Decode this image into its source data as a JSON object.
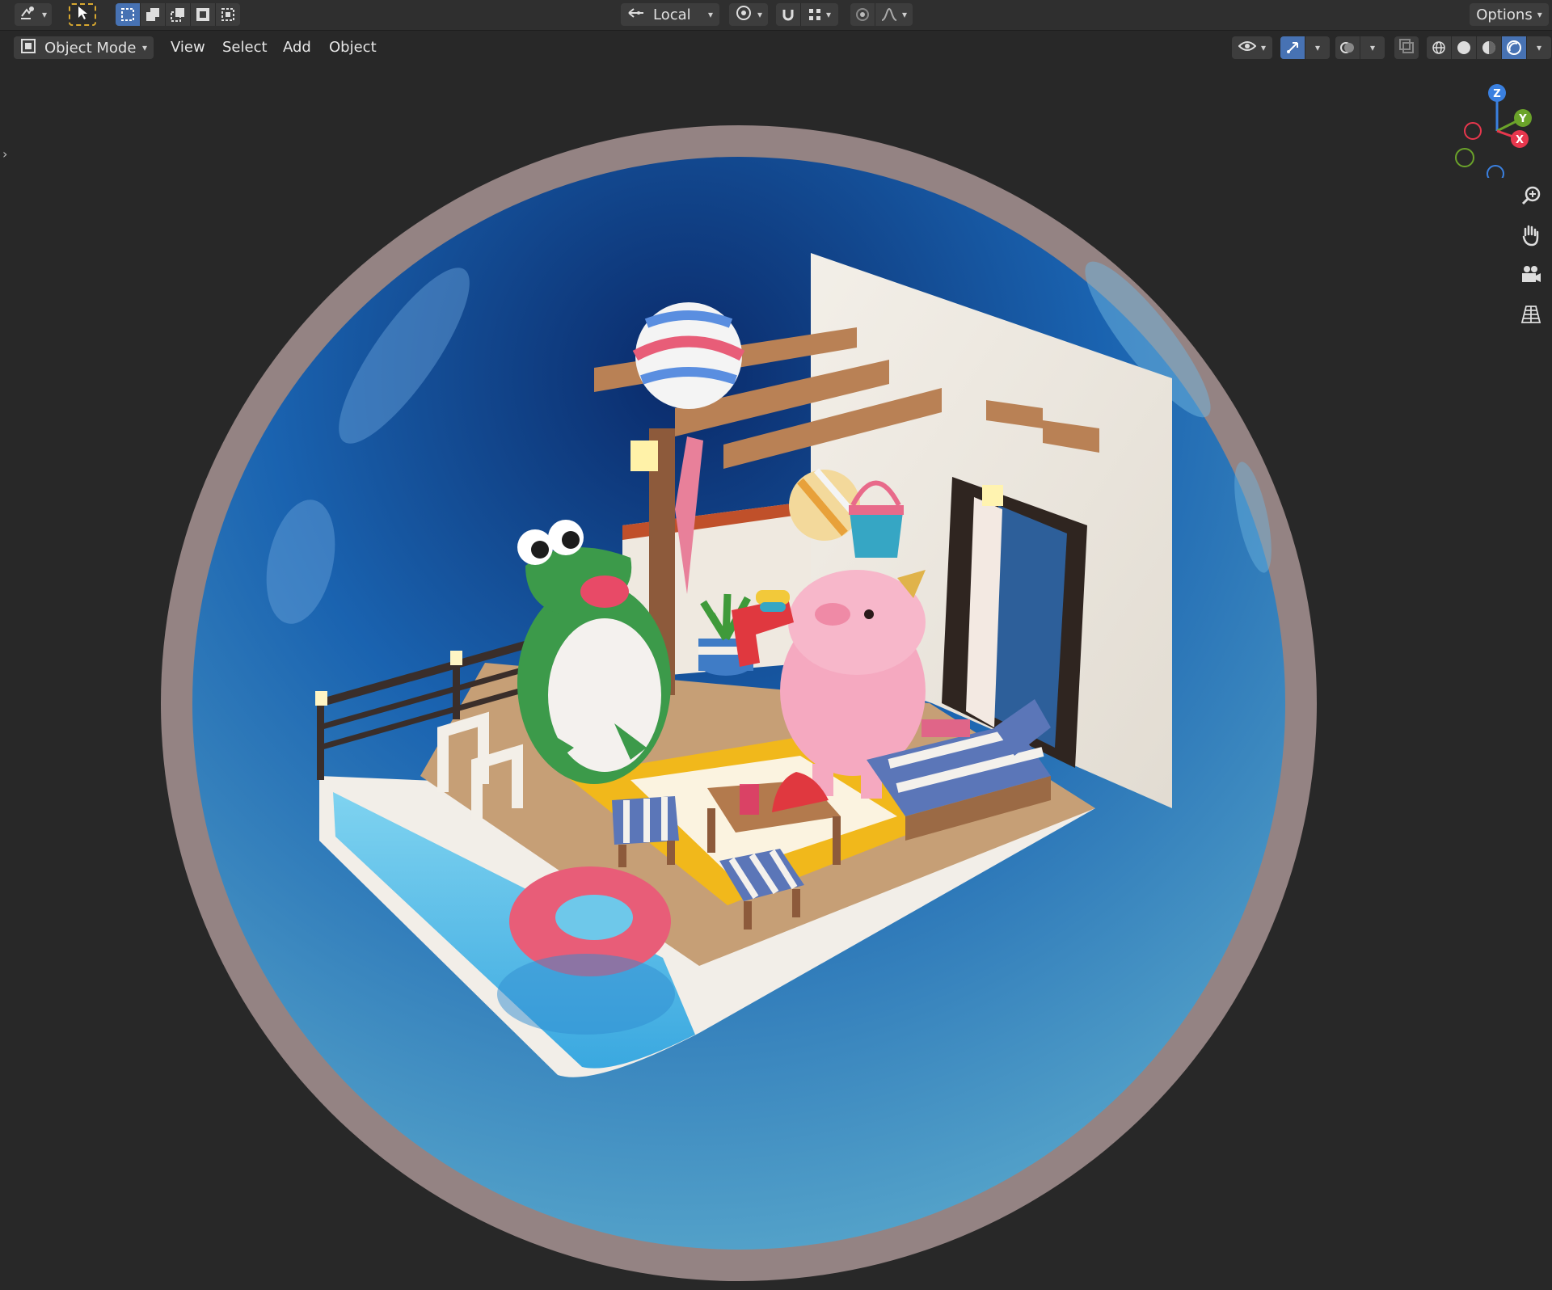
{
  "header": {
    "transform_orientation": "Local",
    "options_label": "Options"
  },
  "viewport_header": {
    "mode_label": "Object Mode",
    "menus": [
      "View",
      "Select",
      "Add",
      "Object"
    ]
  },
  "nav_gizmo": {
    "axes": {
      "z": "Z",
      "y": "Y",
      "x": "X"
    }
  },
  "icons": {
    "editor_type": "editor-type-icon",
    "select_tool": "select-cursor-icon",
    "pivot": "pivot-icon",
    "snap": "magnet-icon",
    "proportional": "proportional-edit-icon",
    "visibility": "eye-icon",
    "gizmo": "gizmo-icon",
    "overlay": "overlay-icon",
    "xray": "xray-icon",
    "shading_modes": [
      "wireframe-icon",
      "solid-icon",
      "material-icon",
      "rendered-icon"
    ],
    "nav": [
      "zoom-icon",
      "hand-icon",
      "camera-icon",
      "grid-icon"
    ]
  },
  "colors": {
    "accent": "#4772b3",
    "x_axis": "#e8374d",
    "y_axis": "#6ba32a",
    "z_axis": "#3a80e0"
  }
}
